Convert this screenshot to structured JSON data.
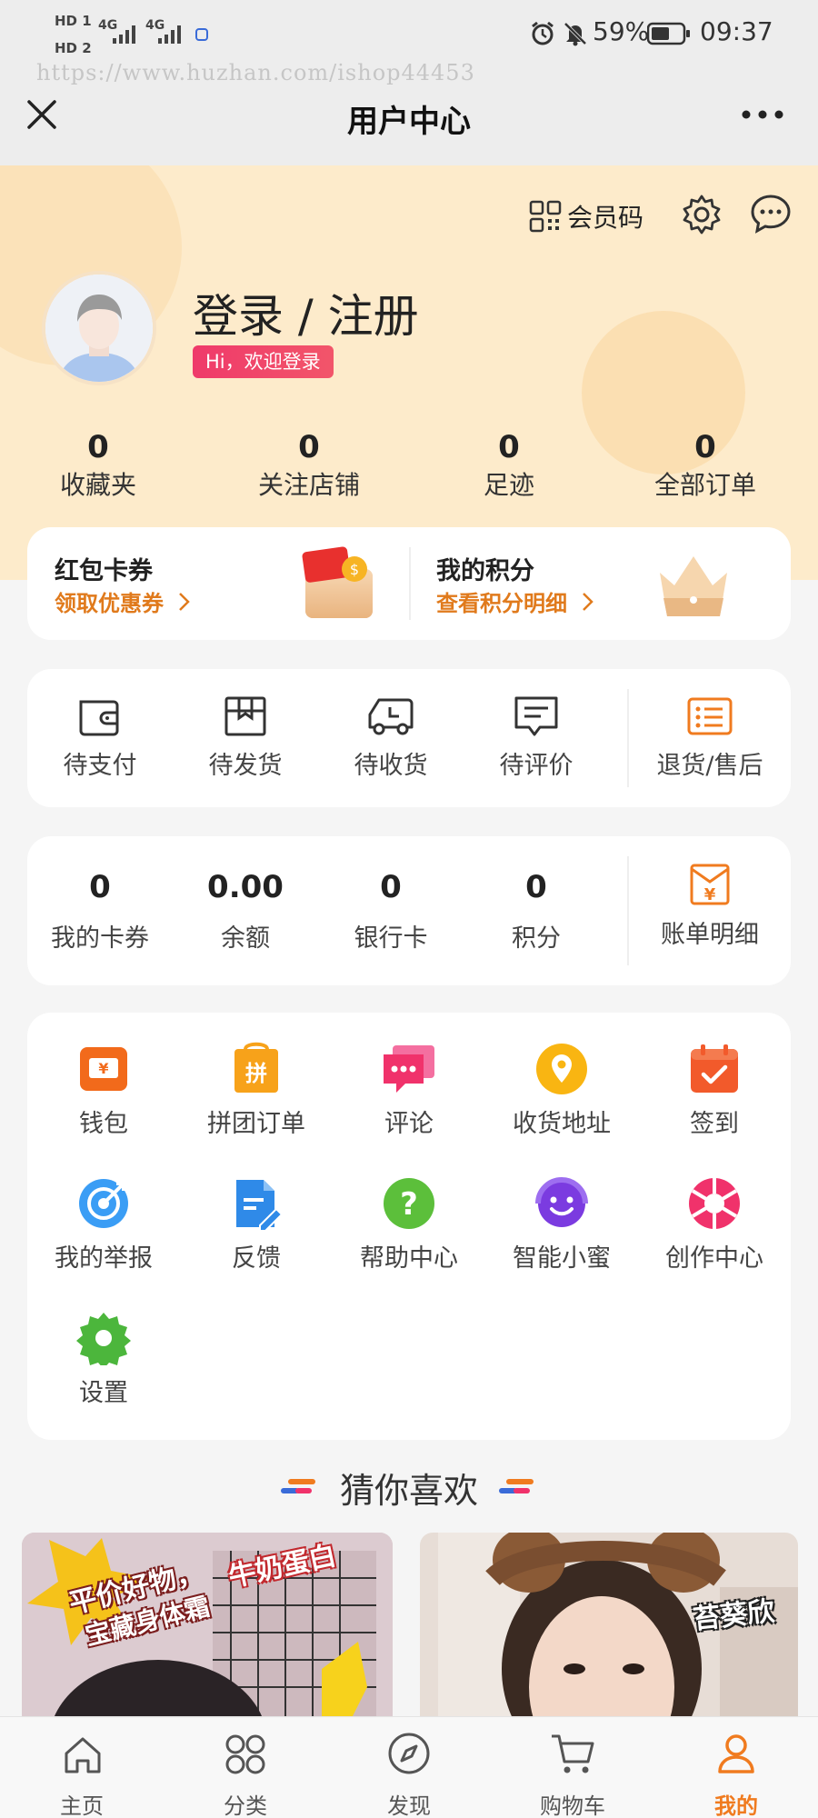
{
  "status_bar": {
    "hd1": "HD 1",
    "hd2": "HD 2",
    "network1": "4G",
    "network2": "4G",
    "battery": "59%",
    "time": "09:37"
  },
  "watermark": "https://www.huzhan.com/ishop44453",
  "nav": {
    "title": "用户中心"
  },
  "header": {
    "member_code": "会员码",
    "login_title": "登录 / 注册",
    "welcome": "Hi，欢迎登录",
    "stats": [
      {
        "value": "0",
        "label": "收藏夹"
      },
      {
        "value": "0",
        "label": "关注店铺"
      },
      {
        "value": "0",
        "label": "足迹"
      },
      {
        "value": "0",
        "label": "全部订单"
      }
    ]
  },
  "coupon_card": {
    "left_title": "红包卡券",
    "left_link": "领取优惠券",
    "right_title": "我的积分",
    "right_link": "查看积分明细"
  },
  "orders": {
    "items": [
      {
        "label": "待支付",
        "icon": "wallet-icon"
      },
      {
        "label": "待发货",
        "icon": "box-icon"
      },
      {
        "label": "待收货",
        "icon": "truck-icon"
      },
      {
        "label": "待评价",
        "icon": "comment-icon"
      }
    ],
    "after_sale": {
      "label": "退货/售后",
      "icon": "list-icon"
    }
  },
  "assets": {
    "items": [
      {
        "value": "0",
        "label": "我的卡券"
      },
      {
        "value": "0.00",
        "label": "余额"
      },
      {
        "value": "0",
        "label": "银行卡"
      },
      {
        "value": "0",
        "label": "积分"
      }
    ],
    "bill": {
      "label": "账单明细",
      "icon": "yen-envelope-icon"
    }
  },
  "services": [
    {
      "label": "钱包",
      "icon": "wallet-ticket-icon",
      "color": "#f26a1b"
    },
    {
      "label": "拼团订单",
      "icon": "group-buy-icon",
      "color": "#f7a21a",
      "glyph": "拼"
    },
    {
      "label": "评论",
      "icon": "chat-bubble-icon",
      "color": "#f0326b"
    },
    {
      "label": "收货地址",
      "icon": "location-icon",
      "color": "#f9b512"
    },
    {
      "label": "签到",
      "icon": "calendar-check-icon",
      "color": "#f25a2b"
    },
    {
      "label": "我的举报",
      "icon": "target-icon",
      "color": "#3a9df5"
    },
    {
      "label": "反馈",
      "icon": "document-edit-icon",
      "color": "#2f8ae8"
    },
    {
      "label": "帮助中心",
      "icon": "help-icon",
      "color": "#5cbf3b",
      "glyph": "?"
    },
    {
      "label": "智能小蜜",
      "icon": "assistant-icon",
      "color": "#7b3be0"
    },
    {
      "label": "创作中心",
      "icon": "aperture-icon",
      "color": "#f0326b"
    },
    {
      "label": "设置",
      "icon": "gear-icon",
      "color": "#4cb63c"
    }
  ],
  "recommend": {
    "title": "猜你喜欢",
    "card1_caption1": "平价好物，",
    "card1_caption2": "宝藏身体霜",
    "card1_tag": "牛奶蛋白",
    "card2_tag": "苔葵欣"
  },
  "tabbar": [
    {
      "label": "主页",
      "icon": "home-icon",
      "active": false
    },
    {
      "label": "分类",
      "icon": "category-icon",
      "active": false
    },
    {
      "label": "发现",
      "icon": "compass-icon",
      "active": false
    },
    {
      "label": "购物车",
      "icon": "cart-icon",
      "active": false
    },
    {
      "label": "我的",
      "icon": "user-icon",
      "active": true
    }
  ],
  "colors": {
    "accent": "#f07b1f",
    "header_bg": "#fdebcb",
    "welcome_badge": "#f0326b",
    "tab_active": "#f07b1f"
  }
}
